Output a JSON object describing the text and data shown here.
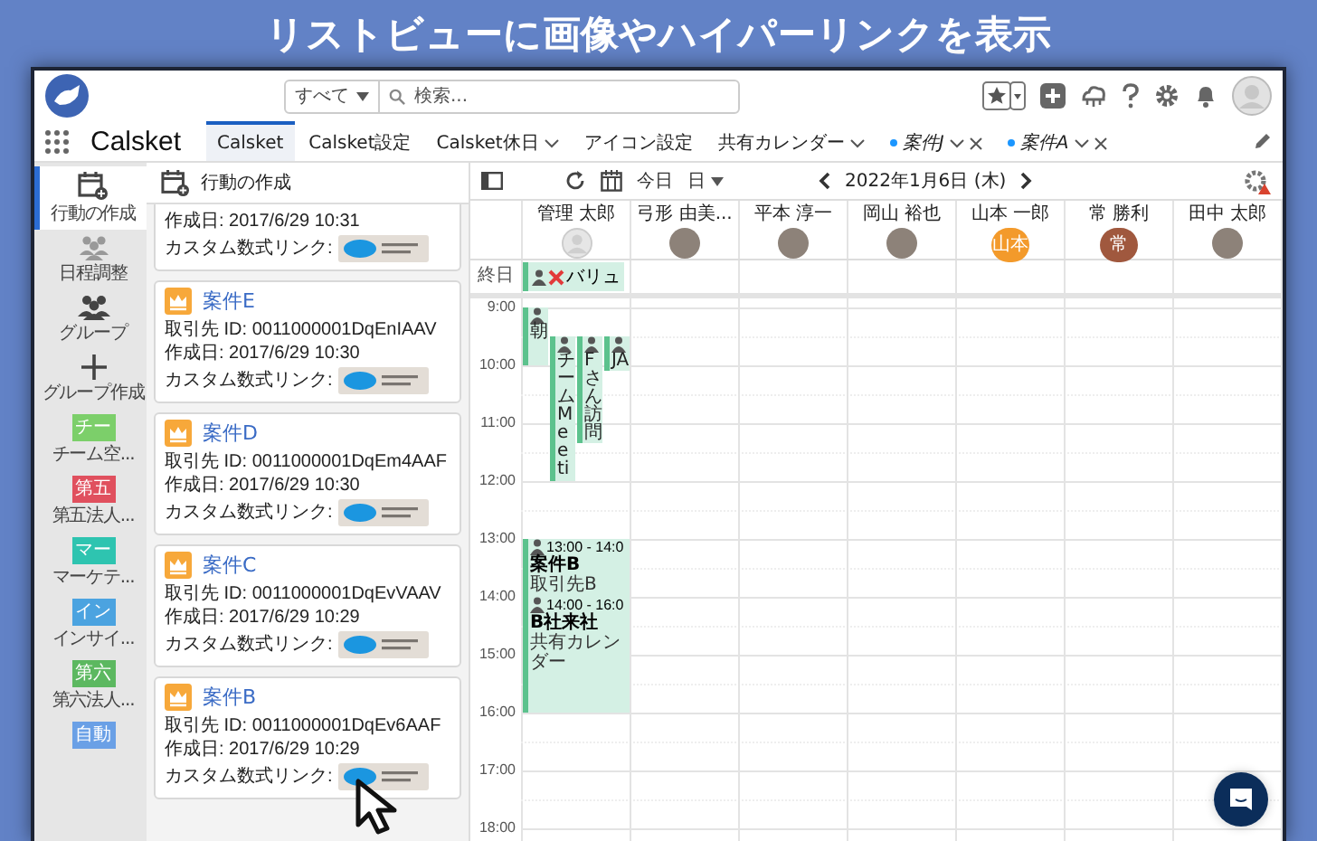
{
  "headline": "リストビューに画像やハイパーリンクを表示",
  "header": {
    "scope": "すべて",
    "search_placeholder": "検索..."
  },
  "app_name": "Calsket",
  "tabs": [
    {
      "label": "Calsket",
      "selected": true,
      "menu": false,
      "closable": false,
      "dot": false
    },
    {
      "label": "Calsket設定",
      "selected": false,
      "menu": false,
      "closable": false,
      "dot": false
    },
    {
      "label": "Calsket休日",
      "selected": false,
      "menu": true,
      "closable": false,
      "dot": false
    },
    {
      "label": "アイコン設定",
      "selected": false,
      "menu": false,
      "closable": false,
      "dot": false
    },
    {
      "label": "共有カレンダー",
      "selected": false,
      "menu": true,
      "closable": false,
      "dot": false
    },
    {
      "label": "案件J",
      "selected": false,
      "menu": true,
      "closable": true,
      "dot": true
    },
    {
      "label": "案件A",
      "selected": false,
      "menu": true,
      "closable": true,
      "dot": true
    }
  ],
  "rail": [
    {
      "kind": "create-event",
      "label": "行動の作成",
      "selected": true
    },
    {
      "kind": "schedule",
      "label": "日程調整",
      "selected": false
    },
    {
      "kind": "group",
      "label": "グループ",
      "selected": false
    },
    {
      "kind": "group-add",
      "label": "グループ作成",
      "selected": false
    },
    {
      "kind": "tile",
      "badge": "チー",
      "label": "チーム空...",
      "color": "#7ccf6a",
      "selected": false
    },
    {
      "kind": "tile",
      "badge": "第五",
      "label": "第五法人...",
      "color": "#e0505e",
      "selected": false
    },
    {
      "kind": "tile",
      "badge": "マー",
      "label": "マーケテ...",
      "color": "#2ec4b0",
      "selected": false
    },
    {
      "kind": "tile",
      "badge": "イン",
      "label": "インサイ...",
      "color": "#4ba3e0",
      "selected": false
    },
    {
      "kind": "tile",
      "badge": "第六",
      "label": "第六法人...",
      "color": "#5cb860",
      "selected": false
    },
    {
      "kind": "tile",
      "badge": "自動",
      "color": "#6aa0e6",
      "selected": false
    }
  ],
  "list_panel": {
    "title": "行動の作成",
    "cards": [
      {
        "fields": [
          {
            "kind": "text",
            "text": "作成日: 2017/6/29 10:31"
          },
          {
            "kind": "badge",
            "text": "カスタム数式リンク:"
          }
        ]
      },
      {
        "title": "案件E",
        "fields": [
          {
            "kind": "text",
            "text": "取引先 ID: 0011000001DqEnIAAV"
          },
          {
            "kind": "text",
            "text": "作成日: 2017/6/29 10:30"
          },
          {
            "kind": "badge",
            "text": "カスタム数式リンク:"
          }
        ]
      },
      {
        "title": "案件D",
        "fields": [
          {
            "kind": "text",
            "text": "取引先 ID: 0011000001DqEm4AAF"
          },
          {
            "kind": "text",
            "text": "作成日: 2017/6/29 10:30"
          },
          {
            "kind": "badge",
            "text": "カスタム数式リンク:"
          }
        ]
      },
      {
        "title": "案件C",
        "fields": [
          {
            "kind": "text",
            "text": "取引先 ID: 0011000001DqEvVAAV"
          },
          {
            "kind": "text",
            "text": "作成日: 2017/6/29 10:29"
          },
          {
            "kind": "badge",
            "text": "カスタム数式リンク:"
          }
        ]
      },
      {
        "title": "案件B",
        "fields": [
          {
            "kind": "text",
            "text": "取引先 ID: 0011000001DqEv6AAF"
          },
          {
            "kind": "text",
            "text": "作成日: 2017/6/29 10:29"
          },
          {
            "kind": "badge",
            "text": "カスタム数式リンク:"
          }
        ]
      }
    ]
  },
  "calendar": {
    "today": "今日",
    "view": "日",
    "date": "2022年1月6日 (木)",
    "all_day_label": "終日",
    "hours": [
      "9:00",
      "10:00",
      "11:00",
      "12:00",
      "13:00",
      "14:00",
      "15:00",
      "16:00",
      "17:00",
      "18:00"
    ],
    "people": [
      {
        "name": "管理 太郎",
        "kind": "default",
        "all_day": [
          {
            "title": "バリュ",
            "kind": "crossed"
          }
        ],
        "events": [
          {
            "title": "朝"
          },
          {
            "title": "チームMeeti"
          },
          {
            "title": "Fさん訪問"
          },
          {
            "title": "JA"
          },
          {
            "time": "13:00 - 14:0",
            "title": "案件B",
            "subtitle": "取引先B"
          },
          {
            "time": "14:00 - 16:0",
            "title": "B社来社",
            "subtitle": "共有カレンダー"
          }
        ]
      },
      {
        "name": "弓形 由美...",
        "kind": "photo"
      },
      {
        "name": "平本 淳一",
        "kind": "photo"
      },
      {
        "name": "岡山 裕也",
        "kind": "photo"
      },
      {
        "name": "山本 一郎",
        "kind": "initials",
        "initials": "山本",
        "color": "#f39a2b"
      },
      {
        "name": "常 勝利",
        "kind": "initials",
        "initials": "常",
        "color": "#a0583e"
      },
      {
        "name": "田中 太郎",
        "kind": "photo"
      }
    ]
  }
}
